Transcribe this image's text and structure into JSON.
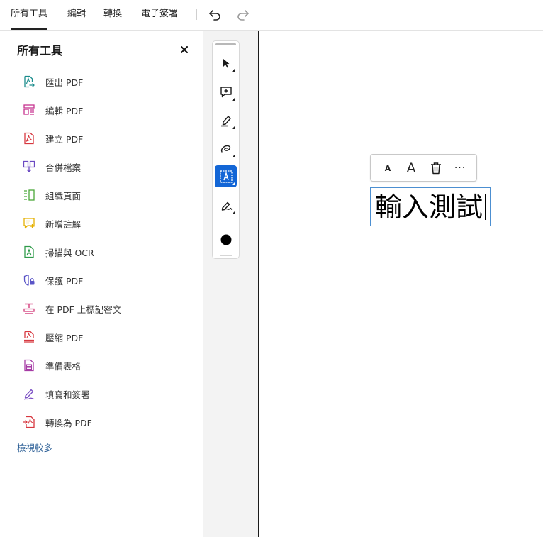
{
  "menu": {
    "tabs": [
      {
        "label": "所有工具",
        "active": true
      },
      {
        "label": "編輯",
        "active": false
      },
      {
        "label": "轉換",
        "active": false
      },
      {
        "label": "電子簽署",
        "active": false
      }
    ],
    "undo_icon": "undo-icon",
    "redo_icon": "redo-icon"
  },
  "panel": {
    "title": "所有工具",
    "close_icon": "close-icon",
    "tools": [
      {
        "label": "匯出 PDF",
        "icon": "export-pdf-icon",
        "color": "#1a8c8c"
      },
      {
        "label": "編輯 PDF",
        "icon": "edit-pdf-icon",
        "color": "#c6338f"
      },
      {
        "label": "建立 PDF",
        "icon": "create-pdf-icon",
        "color": "#d7373f"
      },
      {
        "label": "合併檔案",
        "icon": "combine-files-icon",
        "color": "#6b4ac2"
      },
      {
        "label": "組織頁面",
        "icon": "organize-pages-icon",
        "color": "#4aa839"
      },
      {
        "label": "新增註解",
        "icon": "add-comment-icon",
        "color": "#e5b000"
      },
      {
        "label": "掃描與 OCR",
        "icon": "scan-ocr-icon",
        "color": "#2f9b4a"
      },
      {
        "label": "保護 PDF",
        "icon": "protect-pdf-icon",
        "color": "#5a55c7"
      },
      {
        "label": "在 PDF 上標記密文",
        "icon": "redact-icon",
        "color": "#d23a7a"
      },
      {
        "label": "壓縮 PDF",
        "icon": "compress-pdf-icon",
        "color": "#d7373f"
      },
      {
        "label": "準備表格",
        "icon": "prepare-form-icon",
        "color": "#a63ba5"
      },
      {
        "label": "填寫和簽署",
        "icon": "fill-sign-icon",
        "color": "#7b4fc4"
      },
      {
        "label": "轉換為 PDF",
        "icon": "convert-to-pdf-icon",
        "color": "#d7373f"
      }
    ],
    "see_more": "檢視較多"
  },
  "toolbar": {
    "tools": [
      {
        "name": "select-tool",
        "icon": "cursor-icon",
        "selected": false
      },
      {
        "name": "comment-tool",
        "icon": "add-comment-icon",
        "selected": false
      },
      {
        "name": "highlight-tool",
        "icon": "highlighter-icon",
        "selected": false
      },
      {
        "name": "draw-tool",
        "icon": "freehand-icon",
        "selected": false
      },
      {
        "name": "text-tool",
        "icon": "text-box-icon",
        "selected": true
      },
      {
        "name": "sign-tool",
        "icon": "signature-icon",
        "selected": false
      },
      {
        "name": "color-tool",
        "icon": "color-dot-icon",
        "selected": false
      }
    ],
    "accent": "#1366d6"
  },
  "text_toolbar": {
    "decrease_label": "A",
    "increase_label": "A",
    "delete_icon": "trash-icon",
    "more_label": "···"
  },
  "textbox": {
    "value": "輸入測試"
  }
}
